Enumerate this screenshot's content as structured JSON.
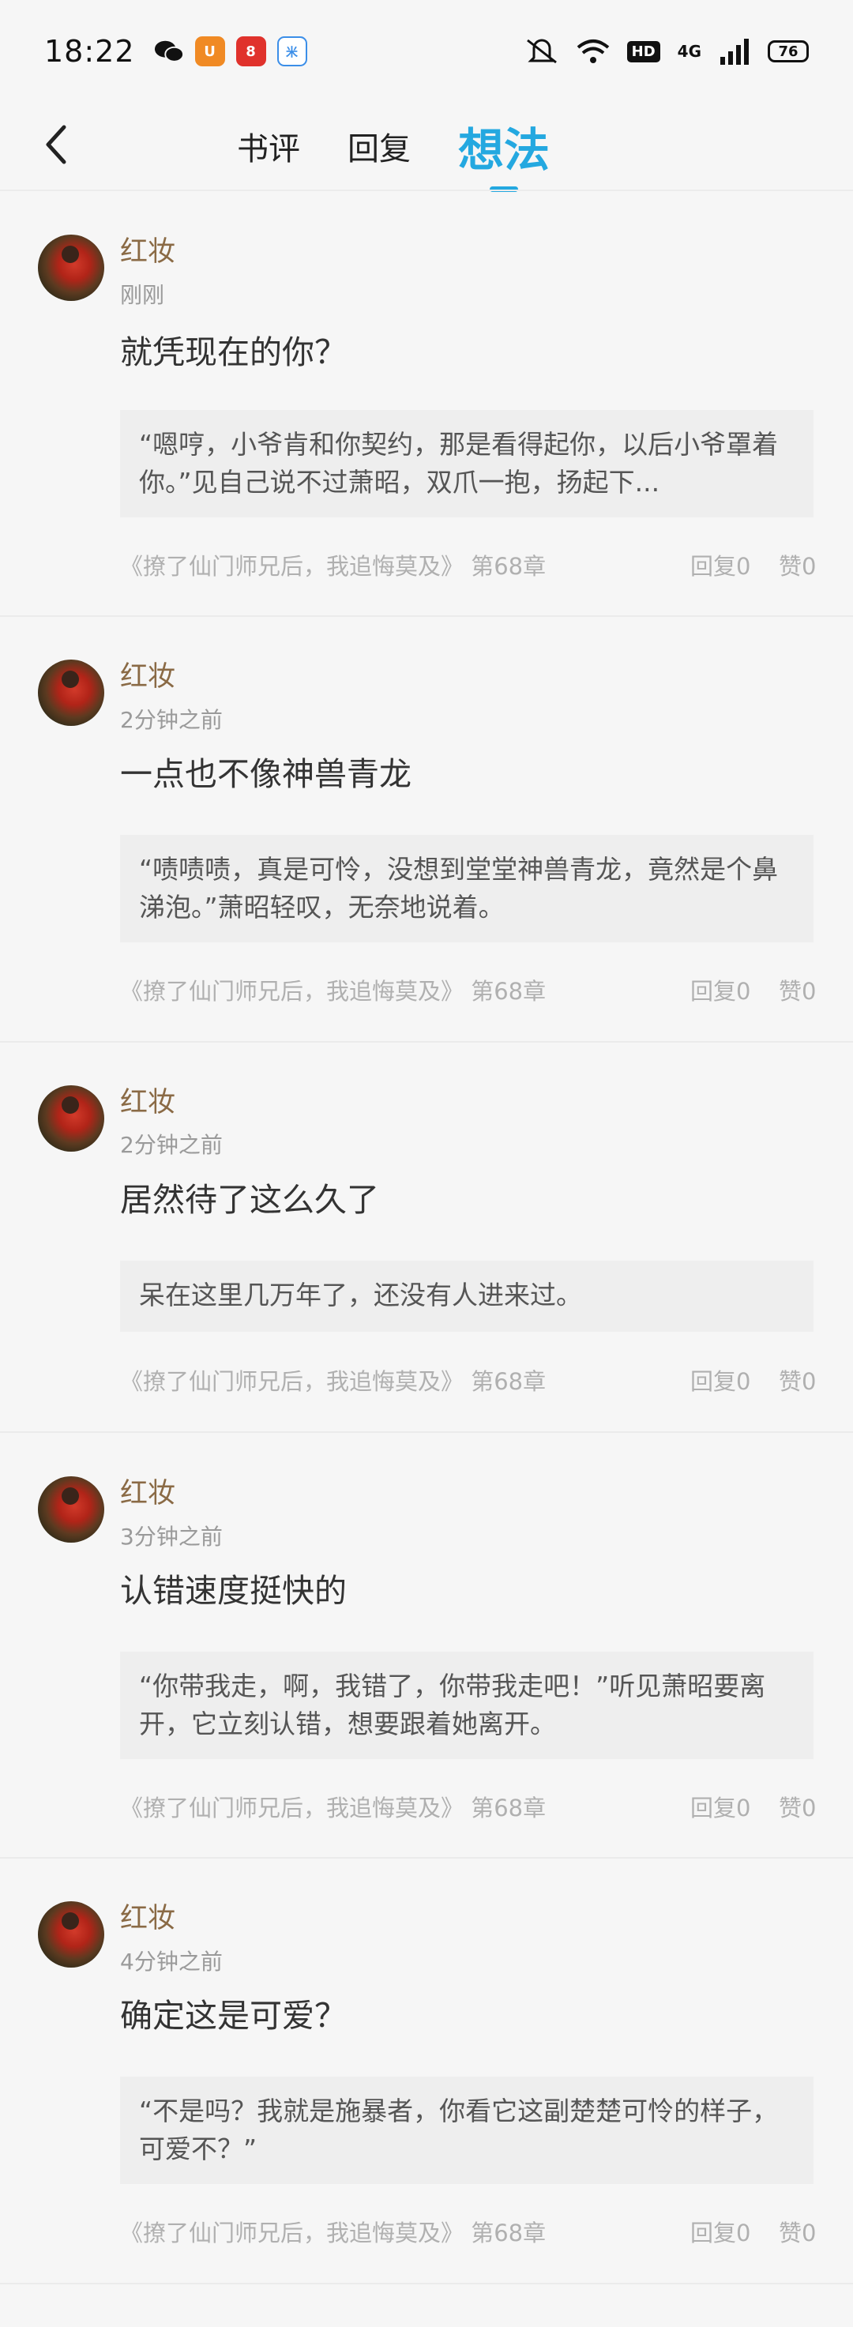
{
  "status_bar": {
    "time": "18:22",
    "battery": "76",
    "network": "4G",
    "hd": "HD",
    "apps": [
      {
        "icon": "wechat-icon",
        "color": "#111111"
      },
      {
        "icon": "uc-browser-icon",
        "color": "#f08a24"
      },
      {
        "icon": "red-app-icon",
        "color": "#e0322c"
      },
      {
        "icon": "blue-app-icon",
        "color": "#3b8ee8"
      }
    ],
    "icons": [
      "mute-icon",
      "wifi-icon",
      "signal-icon"
    ]
  },
  "header": {
    "back_icon": "chevron-left-icon",
    "tabs": [
      {
        "label": "书评",
        "active": false
      },
      {
        "label": "回复",
        "active": false
      },
      {
        "label": "想法",
        "active": true
      }
    ],
    "accent_color": "#24a8e0"
  },
  "posts": [
    {
      "username": "红妆",
      "time": "刚刚",
      "thought": "就凭现在的你？",
      "quote": "“嗯哼，小爷肯和你契约，那是看得起你，以后小爷罩着你。”见自己说不过萧昭，双爪一抱，扬起下...",
      "book": "《撩了仙门师兄后，我追悔莫及》 第68章",
      "replies": "回复0",
      "likes": "赞0"
    },
    {
      "username": "红妆",
      "time": "2分钟之前",
      "thought": "一点也不像神兽青龙",
      "quote": "“啧啧啧，真是可怜，没想到堂堂神兽青龙，竟然是个鼻涕泡。”萧昭轻叹，无奈地说着。",
      "book": "《撩了仙门师兄后，我追悔莫及》 第68章",
      "replies": "回复0",
      "likes": "赞0"
    },
    {
      "username": "红妆",
      "time": "2分钟之前",
      "thought": "居然待了这么久了",
      "quote": "呆在这里几万年了，还没有人进来过。",
      "book": "《撩了仙门师兄后，我追悔莫及》 第68章",
      "replies": "回复0",
      "likes": "赞0"
    },
    {
      "username": "红妆",
      "time": "3分钟之前",
      "thought": "认错速度挺快的",
      "quote": "“你带我走，啊，我错了，你带我走吧！”听见萧昭要离开，它立刻认错，想要跟着她离开。",
      "book": "《撩了仙门师兄后，我追悔莫及》 第68章",
      "replies": "回复0",
      "likes": "赞0"
    },
    {
      "username": "红妆",
      "time": "4分钟之前",
      "thought": "确定这是可爱？",
      "quote": "“不是吗？我就是施暴者，你看它这副楚楚可怜的样子，可爱不？”",
      "book": "《撩了仙门师兄后，我追悔莫及》 第68章",
      "replies": "回复0",
      "likes": "赞0"
    }
  ]
}
